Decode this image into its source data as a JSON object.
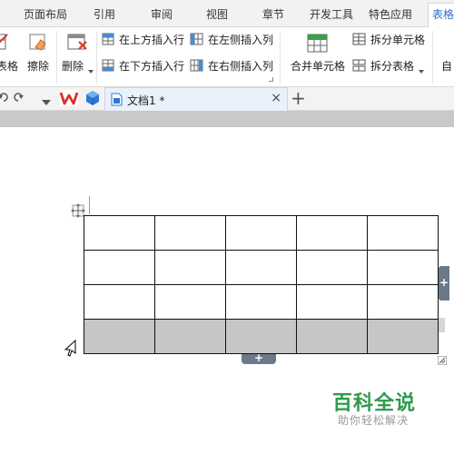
{
  "menu": {
    "tabs": [
      {
        "label": "页面布局"
      },
      {
        "label": "引用"
      },
      {
        "label": "审阅"
      },
      {
        "label": "视图"
      },
      {
        "label": "章节"
      },
      {
        "label": "开发工具"
      },
      {
        "label": "特色应用"
      },
      {
        "label": "表格"
      }
    ],
    "active_tab": "表格"
  },
  "ribbon": {
    "draw_table_label": "表格",
    "erase_label": "擦除",
    "delete_label": "删除",
    "insert_row_above": "在上方插入行",
    "insert_row_below": "在下方插入行",
    "insert_col_left": "在左侧插入列",
    "insert_col_right": "在右侧插入列",
    "merge_cells": "合并单元格",
    "split_cells": "拆分单元格",
    "split_table": "拆分表格",
    "auto_fit": "自"
  },
  "tabbar": {
    "doc_title": "文档1 *",
    "close_glyph": "×",
    "new_tab_glyph": "+"
  },
  "table": {
    "rows": 4,
    "cols": 5,
    "selected_row": 4,
    "add_glyph": "+"
  },
  "watermark": {
    "title": "百科全说",
    "subtitle": "助你轻松解决"
  },
  "colors": {
    "accent": "#2f6fc4",
    "selected_row": "#c6c6c6",
    "watermark_green": "#2e9a4a",
    "wps_red": "#d9322c",
    "cube_blue": "#2b79d6"
  },
  "icons": [
    "move-icon",
    "plus-icon",
    "close-icon",
    "wps-logo-icon",
    "cube-icon",
    "document-icon",
    "undo-icon",
    "redo-icon",
    "dropdown-arrow-icon",
    "eraser-icon",
    "delete-table-icon",
    "insert-row-icon",
    "insert-col-icon",
    "merge-cells-icon",
    "split-cells-icon",
    "split-table-icon",
    "cursor-icon",
    "resize-icon"
  ]
}
